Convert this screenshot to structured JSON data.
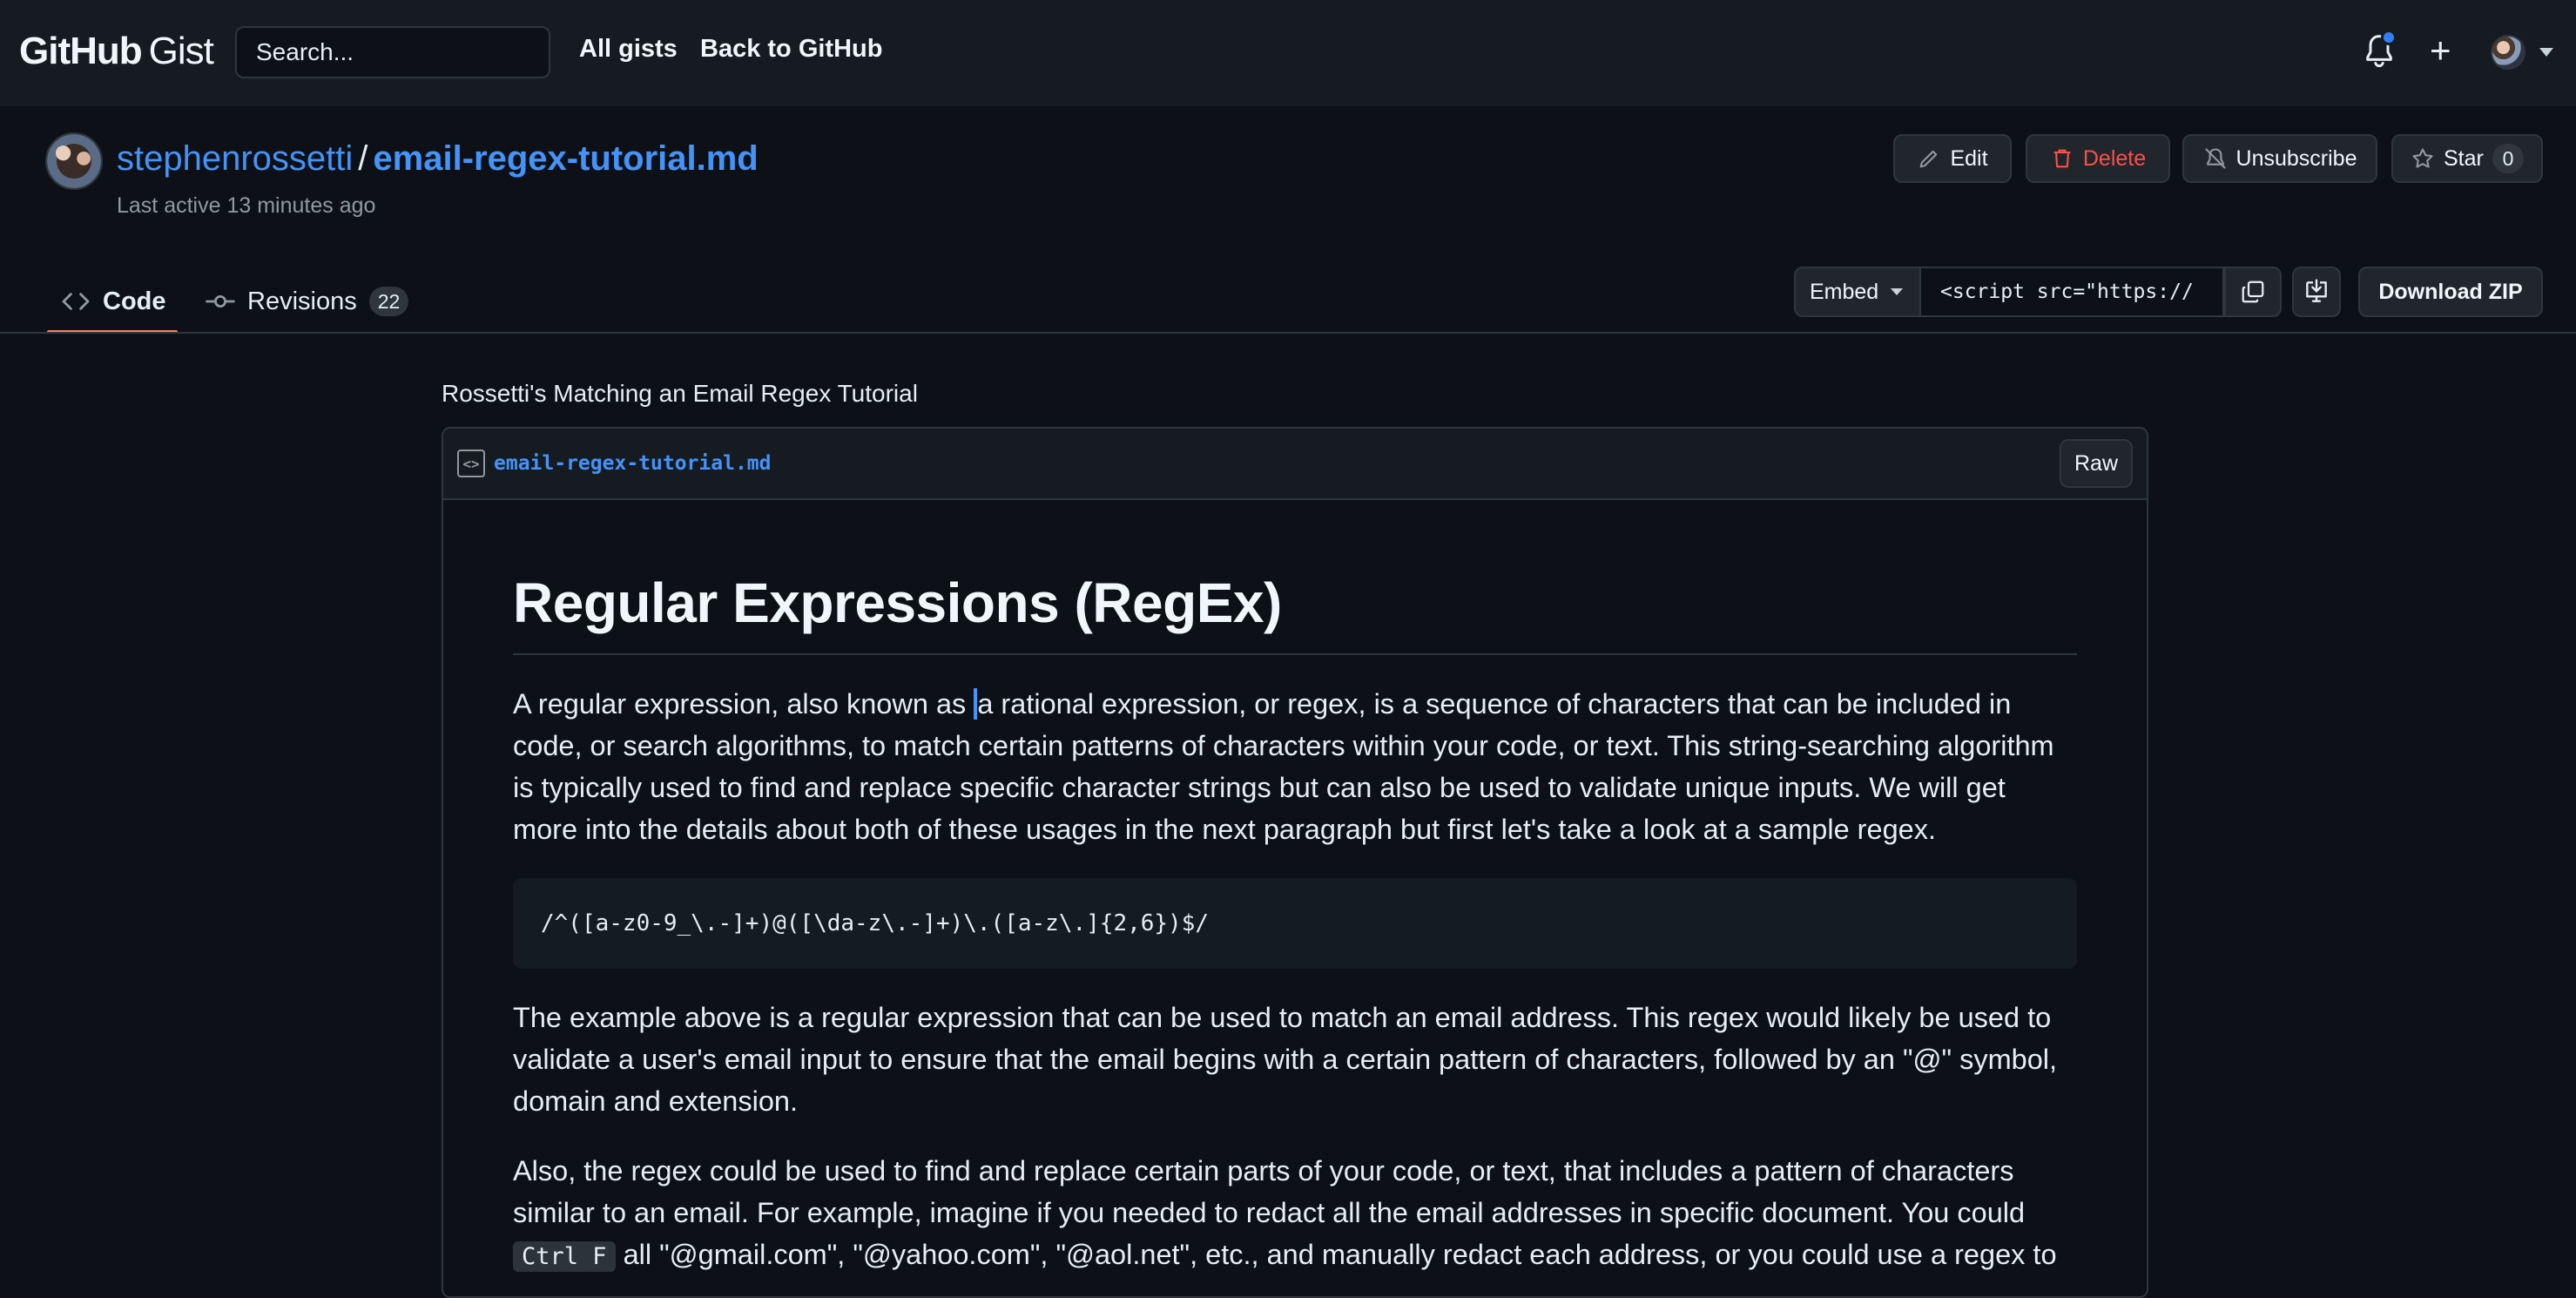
{
  "header": {
    "logo_primary": "GitHub",
    "logo_secondary": "Gist",
    "search_placeholder": "Search...",
    "nav": [
      "All gists",
      "Back to GitHub"
    ],
    "icons": [
      "bell-icon",
      "plus-icon",
      "avatar",
      "chevron-down-icon"
    ]
  },
  "gist": {
    "owner": "stephenrossetti",
    "separator": "/",
    "filename": "email-regex-tutorial.md",
    "last_active": "Last active 13 minutes ago",
    "actions": {
      "edit": "Edit",
      "delete": "Delete",
      "unsubscribe": "Unsubscribe",
      "star": "Star",
      "star_count": "0"
    }
  },
  "tabs": {
    "code": "Code",
    "revisions": "Revisions",
    "revisions_count": "22"
  },
  "embed": {
    "select_label": "Embed",
    "value": "<script src=\"https://",
    "download": "Download ZIP"
  },
  "content": {
    "description": "Rossetti's Matching an Email Regex Tutorial",
    "file_label": "email-regex-tutorial.md",
    "raw_label": "Raw",
    "heading": "Regular Expressions (RegEx)",
    "p1_before": "A regular expression, also known as",
    "p1_after": "a rational expression, or regex, is a sequence of characters that can be included in code, or search algorithms, to match certain patterns of characters within your code, or text. This string-searching algorithm is typically used to find and replace specific character strings but can also be used to validate unique inputs. We will get more into the details about both of these usages in the next paragraph but first let's take a look at a sample regex.",
    "code": "/^([a-z0-9_\\.-]+)@([\\da-z\\.-]+)\\.([a-z\\.]{2,6})$/",
    "p2": "The example above is a regular expression that can be used to match an email address. This regex would likely be used to validate a user's email input to ensure that the email begins with a certain pattern of characters, followed by an \"@\" symbol, domain and extension.",
    "p3_before": "Also, the regex could be used to find and replace certain parts of your code, or text, that includes a pattern of characters similar to an email. For example, imagine if you needed to redact all the email addresses in specific document. You could",
    "p3_code": "Ctrl F",
    "p3_after": "all \"@gmail.com\", \"@yahoo.com\", \"@aol.net\", etc., and manually redact each address, or you could use a regex to"
  },
  "colors": {
    "background": "#0d1117",
    "header_bg": "#161b22",
    "link": "#4493f8",
    "danger": "#f85149",
    "tab_underline": "#f78166",
    "notification_dot": "#2f81f7"
  }
}
